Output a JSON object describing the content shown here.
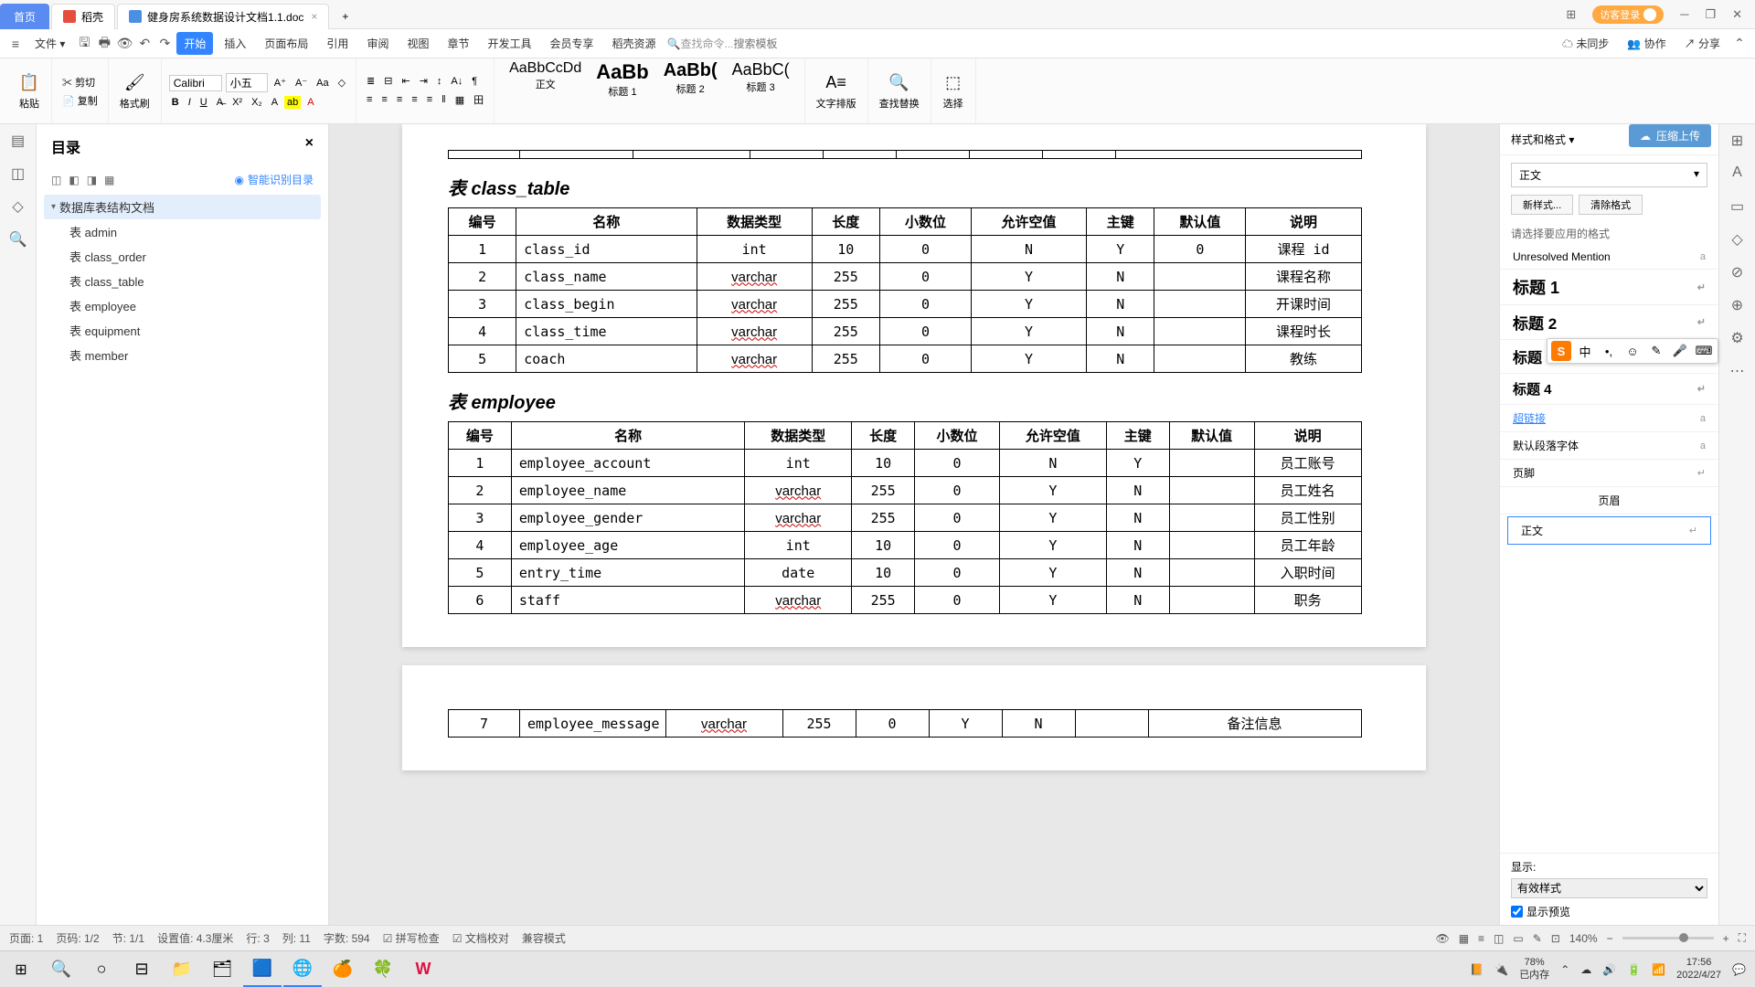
{
  "titlebar": {
    "home_tab": "首页",
    "tab1": "稻壳",
    "tab2": "健身房系统数据设计文档1.1.doc",
    "login": "访客登录"
  },
  "menubar": {
    "file": "文件",
    "start": "开始",
    "insert": "插入",
    "page_layout": "页面布局",
    "reference": "引用",
    "review": "审阅",
    "view": "视图",
    "chapter": "章节",
    "dev": "开发工具",
    "member": "会员专享",
    "docer": "稻壳资源",
    "search_label": "查找命令...",
    "search_placeholder": "搜索模板",
    "cloud": "未同步",
    "coop": "协作",
    "share": "分享"
  },
  "toolbar": {
    "paste": "粘贴",
    "cut": "剪切",
    "copy": "复制",
    "format_paint": "格式刷",
    "font_name": "Calibri",
    "font_size": "小五",
    "style_body": "正文",
    "style_h1": "标题 1",
    "style_h2": "标题 2",
    "style_h3": "标题 3",
    "preview_body": "AaBbCcDd",
    "preview_h1": "AaBb",
    "preview_h2": "AaBb(",
    "preview_h3": "AaBbC(",
    "text_tools": "文字排版",
    "find_replace": "查找替换",
    "select": "选择"
  },
  "outline": {
    "title": "目录",
    "smart": "智能识别目录",
    "root": "数据库表结构文档",
    "items": [
      "表 admin",
      "表 class_order",
      "表 class_table",
      "表 employee",
      "表 equipment",
      "表 member"
    ]
  },
  "doc": {
    "section1": "表 class_table",
    "section2": "表 employee",
    "headers": [
      "编号",
      "名称",
      "数据类型",
      "长度",
      "小数位",
      "允许空值",
      "主键",
      "默认值",
      "说明"
    ],
    "class_table": [
      [
        "1",
        "class_id",
        "int",
        "10",
        "0",
        "N",
        "Y",
        "0",
        "课程 id"
      ],
      [
        "2",
        "class_name",
        "varchar",
        "255",
        "0",
        "Y",
        "N",
        "",
        "课程名称"
      ],
      [
        "3",
        "class_begin",
        "varchar",
        "255",
        "0",
        "Y",
        "N",
        "",
        "开课时间"
      ],
      [
        "4",
        "class_time",
        "varchar",
        "255",
        "0",
        "Y",
        "N",
        "",
        "课程时长"
      ],
      [
        "5",
        "coach",
        "varchar",
        "255",
        "0",
        "Y",
        "N",
        "",
        "教练"
      ]
    ],
    "employee": [
      [
        "1",
        "employee_account",
        "int",
        "10",
        "0",
        "N",
        "Y",
        "",
        "员工账号"
      ],
      [
        "2",
        "employee_name",
        "varchar",
        "255",
        "0",
        "Y",
        "N",
        "",
        "员工姓名"
      ],
      [
        "3",
        "employee_gender",
        "varchar",
        "255",
        "0",
        "Y",
        "N",
        "",
        "员工性别"
      ],
      [
        "4",
        "employee_age",
        "int",
        "10",
        "0",
        "Y",
        "N",
        "",
        "员工年龄"
      ],
      [
        "5",
        "entry_time",
        "date",
        "10",
        "0",
        "Y",
        "N",
        "",
        "入职时间"
      ],
      [
        "6",
        "staff",
        "varchar",
        "255",
        "0",
        "Y",
        "N",
        "",
        "职务"
      ]
    ],
    "employee_p2": [
      [
        "7",
        "employee_message",
        "varchar",
        "255",
        "0",
        "Y",
        "N",
        "",
        "备注信息"
      ]
    ]
  },
  "styles": {
    "title": "样式和格式",
    "current": "正文",
    "new_style": "新样式...",
    "clear": "清除格式",
    "hint": "请选择要应用的格式",
    "unresolved": "Unresolved Mention",
    "h1": "标题 1",
    "h2": "标题 2",
    "h3": "标题 3",
    "h4": "标题 4",
    "hyperlink": "超链接",
    "default_font": "默认段落字体",
    "footer": "页脚",
    "header": "页眉",
    "body": "正文",
    "show_label": "显示:",
    "show_value": "有效样式",
    "preview_check": "显示预览"
  },
  "upload": "压缩上传",
  "status": {
    "page": "页面: 1",
    "pages": "页码: 1/2",
    "sections": "节: 1/1",
    "pos": "设置值: 4.3厘米",
    "line": "行: 3",
    "col": "列: 11",
    "words": "字数: 594",
    "spell": "拼写检查",
    "proof": "文档校对",
    "compat": "兼容模式",
    "zoom": "140%"
  },
  "tray": {
    "battery": "78%",
    "saved": "已内存",
    "time": "17:56",
    "date": "2022/4/27"
  }
}
